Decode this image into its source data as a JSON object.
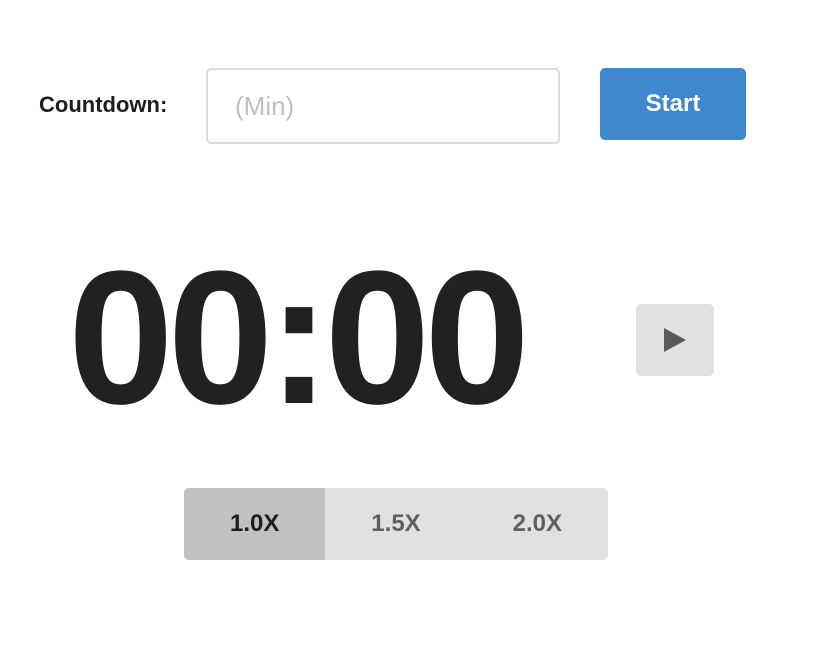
{
  "countdown": {
    "label": "Countdown:",
    "input_value": "",
    "input_placeholder": "(Min)",
    "start_label": "Start"
  },
  "timer": {
    "display": "00:00",
    "play_icon": "play-icon"
  },
  "speed": {
    "options": [
      {
        "label": "1.0X",
        "active": true
      },
      {
        "label": "1.5X",
        "active": false
      },
      {
        "label": "2.0X",
        "active": false
      }
    ]
  },
  "colors": {
    "accent": "#3f88d0",
    "button_gray": "#e0e1e2",
    "active_gray": "#c0c1c2",
    "text_dark": "#212121"
  }
}
